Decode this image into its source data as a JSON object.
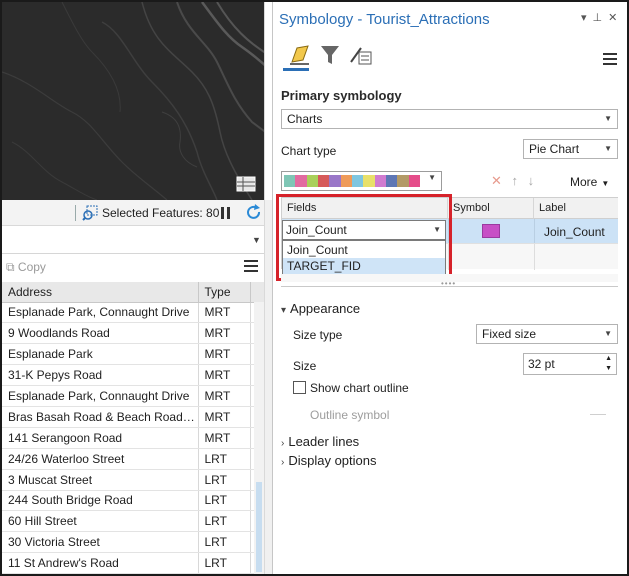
{
  "map_status": {
    "selected_features_label": "Selected Features: 80"
  },
  "attribute_table": {
    "copy_label": "Copy",
    "columns": [
      "Address",
      "Type"
    ],
    "rows": [
      [
        "Esplanade Park, Connaught Drive",
        "MRT"
      ],
      [
        "9 Woodlands Road",
        "MRT"
      ],
      [
        "Esplanade Park",
        "MRT"
      ],
      [
        "31-K Pepys Road",
        "MRT"
      ],
      [
        "Esplanade Park, Connaught Drive",
        "MRT"
      ],
      [
        "Bras Basah Road & Beach Road inte...",
        "MRT"
      ],
      [
        "141 Serangoon Road",
        "MRT"
      ],
      [
        "24/26 Waterloo Street",
        "LRT"
      ],
      [
        "3 Muscat Street",
        "LRT"
      ],
      [
        "244 South Bridge Road",
        "LRT"
      ],
      [
        "60 Hill Street",
        "LRT"
      ],
      [
        "30 Victoria Street",
        "LRT"
      ],
      [
        "11 St Andrew's Road",
        "LRT"
      ]
    ]
  },
  "symbology": {
    "title": "Symbology - Tourist_Attractions",
    "primary_symbology_label": "Primary symbology",
    "primary_symbology_value": "Charts",
    "chart_type_label": "Chart type",
    "chart_type_value": "Pie Chart",
    "more_label": "More",
    "color_ramp": [
      "#7fc6b5",
      "#e26ba0",
      "#a9d05a",
      "#d65a5a",
      "#9a77c8",
      "#ef9b5a",
      "#7fc6e0",
      "#e8e06a",
      "#d07bd0",
      "#5e77b5",
      "#b39a67",
      "#e54d8a"
    ],
    "fields_grid": {
      "col_fields": "Fields",
      "col_symbol": "Symbol",
      "col_label": "Label",
      "row_field_value": "Join_Count",
      "row_symbol_color": "#c74fc6",
      "row_label": "Join_Count",
      "dropdown_options": [
        "Join_Count",
        "TARGET_FID"
      ],
      "highlighted_option": "TARGET_FID"
    },
    "appearance": {
      "section_label": "Appearance",
      "size_type_label": "Size type",
      "size_type_value": "Fixed size",
      "size_label": "Size",
      "size_value": "32 pt",
      "show_outline_label": "Show chart outline",
      "show_outline_checked": false,
      "outline_symbol_label": "Outline symbol"
    },
    "leader_lines_label": "Leader lines",
    "display_options_label": "Display options"
  }
}
